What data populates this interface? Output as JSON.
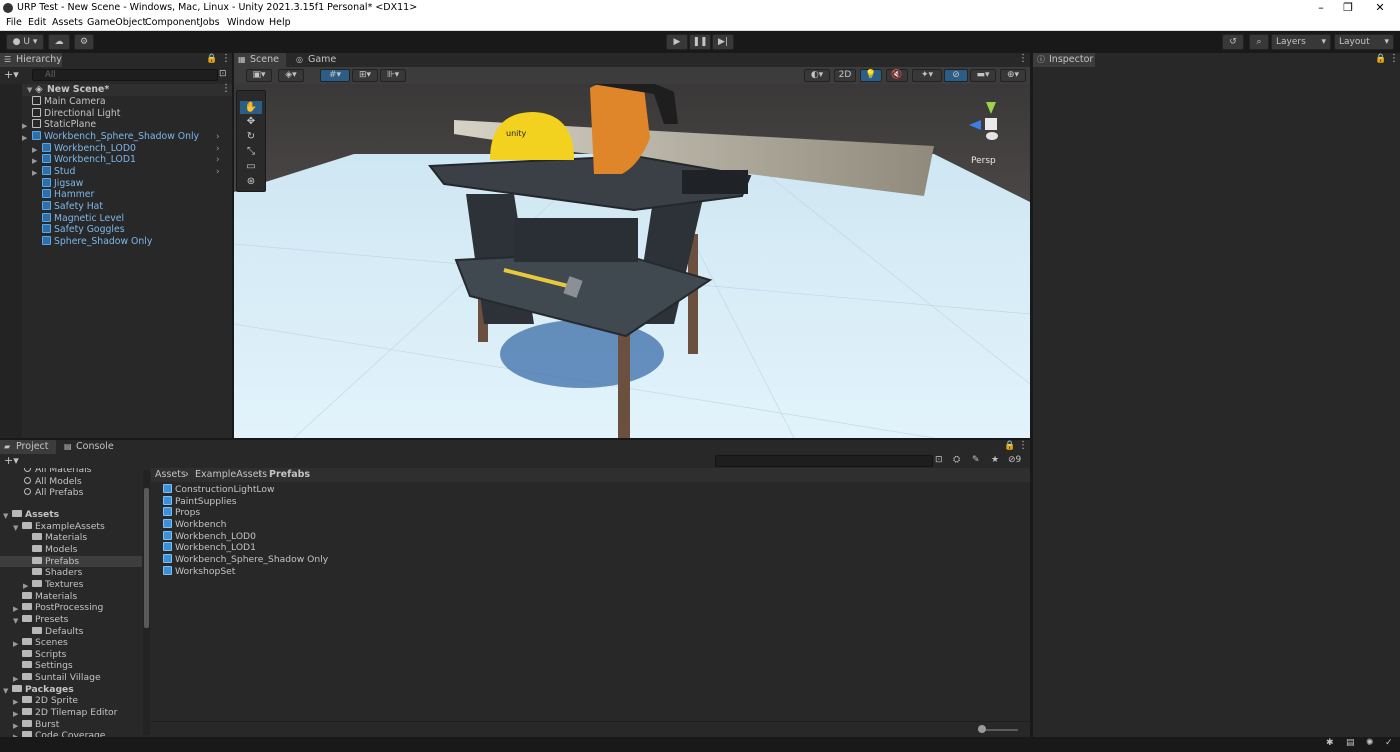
{
  "window": {
    "title": "URP Test - New Scene - Windows, Mac, Linux - Unity 2021.3.15f1 Personal* <DX11>",
    "controls": [
      "–",
      "❐",
      "✕"
    ]
  },
  "menu": [
    "File",
    "Edit",
    "Assets",
    "GameObject",
    "Component",
    "Jobs",
    "Window",
    "Help"
  ],
  "toolbar": {
    "account_label": "U",
    "layers_label": "Layers",
    "layout_label": "Layout",
    "play_icon": "play-icon",
    "pause_icon": "pause-icon",
    "step_icon": "step-icon"
  },
  "hierarchy": {
    "tab_label": "Hierarchy",
    "search_placeholder": "All",
    "scene_name": "New Scene*",
    "items": [
      {
        "label": "Main Camera",
        "depth": 1,
        "prefab": false,
        "expandable": false
      },
      {
        "label": "Directional Light",
        "depth": 1,
        "prefab": false,
        "expandable": false
      },
      {
        "label": "StaticPlane",
        "depth": 1,
        "prefab": false,
        "expandable": true
      },
      {
        "label": "Workbench_Sphere_Shadow Only",
        "depth": 1,
        "prefab": true,
        "expandable": true,
        "selected": false
      },
      {
        "label": "Workbench_LOD0",
        "depth": 2,
        "prefab": true,
        "expandable": true
      },
      {
        "label": "Workbench_LOD1",
        "depth": 2,
        "prefab": true,
        "expandable": true
      },
      {
        "label": "Stud",
        "depth": 2,
        "prefab": true,
        "expandable": true
      },
      {
        "label": "Jigsaw",
        "depth": 2,
        "prefab": true,
        "expandable": false
      },
      {
        "label": "Hammer",
        "depth": 2,
        "prefab": true,
        "expandable": false
      },
      {
        "label": "Safety Hat",
        "depth": 2,
        "prefab": true,
        "expandable": false
      },
      {
        "label": "Magnetic Level",
        "depth": 2,
        "prefab": true,
        "expandable": false
      },
      {
        "label": "Safety Goggles",
        "depth": 2,
        "prefab": true,
        "expandable": false
      },
      {
        "label": "Sphere_Shadow Only",
        "depth": 2,
        "prefab": true,
        "expandable": false
      }
    ]
  },
  "scene": {
    "tabs": [
      "Scene",
      "Game"
    ],
    "toggle_2d": "2D",
    "persp_label": "Persp",
    "hat_logo_text": "unity"
  },
  "inspector": {
    "tab_label": "Inspector"
  },
  "project": {
    "tabs": [
      "Project",
      "Console"
    ],
    "favorites": [
      "All Materials",
      "All Models",
      "All Prefabs"
    ],
    "tree": [
      {
        "label": "Assets",
        "depth": 0,
        "bold": true,
        "open": true
      },
      {
        "label": "ExampleAssets",
        "depth": 1,
        "open": true
      },
      {
        "label": "Materials",
        "depth": 2
      },
      {
        "label": "Models",
        "depth": 2
      },
      {
        "label": "Prefabs",
        "depth": 2,
        "selected": true
      },
      {
        "label": "Shaders",
        "depth": 2
      },
      {
        "label": "Textures",
        "depth": 2,
        "expandable": true
      },
      {
        "label": "Materials",
        "depth": 1
      },
      {
        "label": "PostProcessing",
        "depth": 1,
        "expandable": true
      },
      {
        "label": "Presets",
        "depth": 1,
        "open": true
      },
      {
        "label": "Defaults",
        "depth": 2
      },
      {
        "label": "Scenes",
        "depth": 1,
        "expandable": true
      },
      {
        "label": "Scripts",
        "depth": 1
      },
      {
        "label": "Settings",
        "depth": 1
      },
      {
        "label": "Suntail Village",
        "depth": 1,
        "expandable": true
      },
      {
        "label": "Packages",
        "depth": 0,
        "bold": true,
        "open": true
      },
      {
        "label": "2D Sprite",
        "depth": 1,
        "expandable": true
      },
      {
        "label": "2D Tilemap Editor",
        "depth": 1,
        "expandable": true
      },
      {
        "label": "Burst",
        "depth": 1,
        "expandable": true
      },
      {
        "label": "Code Coverage",
        "depth": 1,
        "expandable": true
      }
    ],
    "breadcrumb": [
      "Assets",
      "ExampleAssets",
      "Prefabs"
    ],
    "files": [
      "ConstructionLightLow",
      "PaintSupplies",
      "Props",
      "Workbench",
      "Workbench_LOD0",
      "Workbench_LOD1",
      "Workbench_Sphere_Shadow Only",
      "WorkshopSet"
    ],
    "hidden_count": "9"
  },
  "colors": {
    "accent_blue": "#7db7ec",
    "panel": "#282828",
    "background": "#191919",
    "selection": "#2c5d87"
  }
}
